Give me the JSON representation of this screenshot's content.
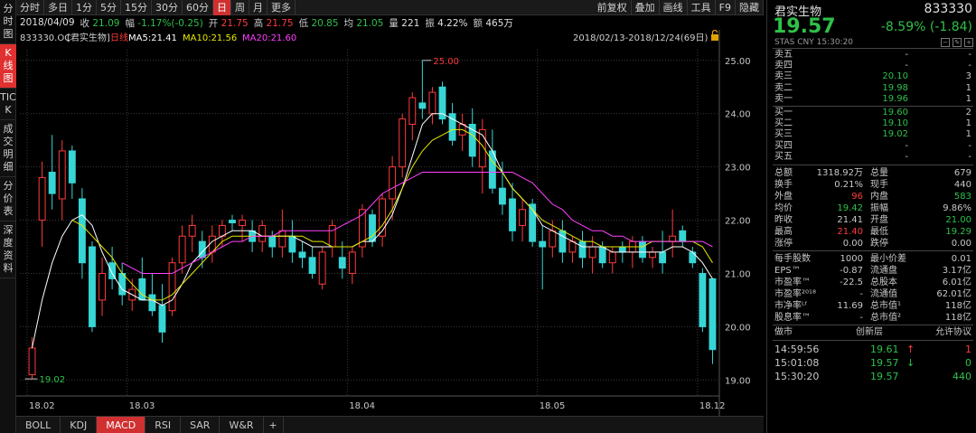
{
  "sidebar": [
    "分时图",
    "K线图",
    "TICK",
    "成交明细",
    "分价表",
    "深度资料"
  ],
  "toolbar": {
    "tabs": [
      "分时",
      "多日",
      "1分",
      "5分",
      "15分",
      "30分",
      "60分",
      "日",
      "周",
      "月",
      "更多"
    ],
    "active": "日",
    "right": [
      "前复权",
      "叠加",
      "画线",
      "工具",
      "F9",
      "隐藏"
    ]
  },
  "info": {
    "date": "2018/04/09",
    "recv_l": "收",
    "recv": "21.09",
    "amp_l": "幅",
    "amp": "-1.17%(-0.25)",
    "open_l": "开",
    "open": "21.75",
    "high_l": "高",
    "high": "21.75",
    "low_l": "低",
    "low": "20.85",
    "avg_l": "均",
    "avg": "21.05",
    "vol_l": "量",
    "vol": "221",
    "swing_l": "振",
    "swing": "4.22%",
    "amt_l": "额",
    "amt": "465万"
  },
  "legend": {
    "code": "833330.OC",
    "name": "[君实生物]",
    "period": "日线",
    "ma5": "MA5:21.41",
    "ma10": "MA10:21.56",
    "ma20": "MA20:21.60",
    "range": "2018/02/13-2018/12/24(69日)"
  },
  "chart_data": {
    "type": "candlestick",
    "ylim": [
      18.7,
      25.2
    ],
    "y_ticks": [
      19.0,
      20.0,
      21.0,
      22.0,
      23.0,
      24.0,
      25.0
    ],
    "x_ticks": [
      "18.02",
      "18.03",
      "18.04",
      "18.05",
      "18.12"
    ],
    "max_label": "25.00",
    "min_label": "19.02",
    "ohlc": [
      [
        19.1,
        19.8,
        19.02,
        19.6
      ],
      [
        22.0,
        23.1,
        21.5,
        22.8
      ],
      [
        22.9,
        23.6,
        22.2,
        22.5
      ],
      [
        22.4,
        23.5,
        22.0,
        23.3
      ],
      [
        23.3,
        23.4,
        22.4,
        22.7
      ],
      [
        22.4,
        22.6,
        20.9,
        21.2
      ],
      [
        21.5,
        21.6,
        19.9,
        20.0
      ],
      [
        20.5,
        21.3,
        20.2,
        21.0
      ],
      [
        21.2,
        21.5,
        20.7,
        20.9
      ],
      [
        21.0,
        21.2,
        20.4,
        20.6
      ],
      [
        20.5,
        20.9,
        20.3,
        20.7
      ],
      [
        20.9,
        21.3,
        20.5,
        20.5
      ],
      [
        20.6,
        21.0,
        20.2,
        20.3
      ],
      [
        20.4,
        20.8,
        19.7,
        19.9
      ],
      [
        20.3,
        21.3,
        20.2,
        21.2
      ],
      [
        21.2,
        21.9,
        21.0,
        21.7
      ],
      [
        21.7,
        22.1,
        21.4,
        21.9
      ],
      [
        21.6,
        21.8,
        21.1,
        21.3
      ],
      [
        21.4,
        21.9,
        21.2,
        21.7
      ],
      [
        21.7,
        22.0,
        21.5,
        21.9
      ],
      [
        22.0,
        22.1,
        21.8,
        21.95
      ],
      [
        21.9,
        22.1,
        21.6,
        22.0
      ],
      [
        21.8,
        22.0,
        21.4,
        21.6
      ],
      [
        21.6,
        22.0,
        21.4,
        21.9
      ],
      [
        21.7,
        21.8,
        21.3,
        21.5
      ],
      [
        21.5,
        22.2,
        21.3,
        21.8
      ],
      [
        21.7,
        22.0,
        21.2,
        21.4
      ],
      [
        21.4,
        21.6,
        21.1,
        21.3
      ],
      [
        21.3,
        21.5,
        20.9,
        21.0
      ],
      [
        20.8,
        21.5,
        20.7,
        21.4
      ],
      [
        21.5,
        22.0,
        21.3,
        21.9
      ],
      [
        21.3,
        21.6,
        20.9,
        21.1
      ],
      [
        21.0,
        21.5,
        20.8,
        21.4
      ],
      [
        21.5,
        22.3,
        21.3,
        22.2
      ],
      [
        22.1,
        22.2,
        21.5,
        21.6
      ],
      [
        21.7,
        22.5,
        21.5,
        22.4
      ],
      [
        22.4,
        23.2,
        22.0,
        23.0
      ],
      [
        23.0,
        24.0,
        22.8,
        23.9
      ],
      [
        23.8,
        24.4,
        23.5,
        24.3
      ],
      [
        24.2,
        25.0,
        23.9,
        24.1
      ],
      [
        24.0,
        24.5,
        23.8,
        24.4
      ],
      [
        24.5,
        24.6,
        23.8,
        23.9
      ],
      [
        24.0,
        24.2,
        23.4,
        23.5
      ],
      [
        23.6,
        24.0,
        23.3,
        23.8
      ],
      [
        23.8,
        24.1,
        23.0,
        23.2
      ],
      [
        23.0,
        23.9,
        22.5,
        23.7
      ],
      [
        23.3,
        23.7,
        22.5,
        22.6
      ],
      [
        22.6,
        23.1,
        22.1,
        22.3
      ],
      [
        22.4,
        22.7,
        21.6,
        21.8
      ],
      [
        21.9,
        22.4,
        21.6,
        22.2
      ],
      [
        22.3,
        22.4,
        21.5,
        21.6
      ],
      [
        21.6,
        21.9,
        20.7,
        21.5
      ],
      [
        21.5,
        22.0,
        21.3,
        21.8
      ],
      [
        21.8,
        22.0,
        21.2,
        21.4
      ],
      [
        21.4,
        21.7,
        21.2,
        21.6
      ],
      [
        21.6,
        21.8,
        21.1,
        21.3
      ],
      [
        21.3,
        21.7,
        21.0,
        21.5
      ],
      [
        21.5,
        21.6,
        21.1,
        21.2
      ],
      [
        21.2,
        21.5,
        21.0,
        21.4
      ],
      [
        21.5,
        21.6,
        21.2,
        21.4
      ],
      [
        21.4,
        21.7,
        21.1,
        21.6
      ],
      [
        21.6,
        21.7,
        21.2,
        21.3
      ],
      [
        21.3,
        21.5,
        21.1,
        21.4
      ],
      [
        21.4,
        21.8,
        21.0,
        21.2
      ],
      [
        21.6,
        22.2,
        21.3,
        21.7
      ],
      [
        21.8,
        21.9,
        21.5,
        21.6
      ],
      [
        21.4,
        21.5,
        21.1,
        21.2
      ],
      [
        21.0,
        21.1,
        19.9,
        20.0
      ],
      [
        20.9,
        20.9,
        19.3,
        19.57
      ]
    ],
    "ma5": [
      19.6,
      20.5,
      21.2,
      21.7,
      22.0,
      22.1,
      21.9,
      21.4,
      21.0,
      20.7,
      20.6,
      20.5,
      20.5,
      20.4,
      20.5,
      20.8,
      21.2,
      21.4,
      21.6,
      21.7,
      21.8,
      21.8,
      21.8,
      21.7,
      21.7,
      21.7,
      21.7,
      21.6,
      21.5,
      21.5,
      21.5,
      21.5,
      21.5,
      21.6,
      21.6,
      21.8,
      22.1,
      22.6,
      23.2,
      23.8,
      24.0,
      24.0,
      23.9,
      23.8,
      23.7,
      23.6,
      23.3,
      22.9,
      22.6,
      22.4,
      22.2,
      21.9,
      21.8,
      21.7,
      21.6,
      21.5,
      21.5,
      21.5,
      21.4,
      21.4,
      21.4,
      21.4,
      21.4,
      21.4,
      21.5,
      21.5,
      21.4,
      21.2,
      20.9
    ],
    "ma10": [
      null,
      null,
      null,
      null,
      22.0,
      21.9,
      21.7,
      21.5,
      21.3,
      21.0,
      20.8,
      20.6,
      20.5,
      20.5,
      20.6,
      20.8,
      21.0,
      21.2,
      21.4,
      21.6,
      21.7,
      21.7,
      21.7,
      21.7,
      21.7,
      21.7,
      21.7,
      21.7,
      21.6,
      21.6,
      21.5,
      21.5,
      21.5,
      21.6,
      21.7,
      21.9,
      22.2,
      22.6,
      23.0,
      23.3,
      23.5,
      23.6,
      23.7,
      23.7,
      23.6,
      23.4,
      23.1,
      22.9,
      22.6,
      22.4,
      22.2,
      22.0,
      21.9,
      21.8,
      21.7,
      21.6,
      21.6,
      21.5,
      21.5,
      21.5,
      21.5,
      21.5,
      21.6,
      21.6,
      21.6,
      21.6,
      21.6,
      21.5,
      21.2
    ],
    "ma20": [
      null,
      null,
      null,
      null,
      null,
      null,
      null,
      null,
      null,
      21.2,
      21.1,
      21.0,
      21.0,
      21.0,
      21.0,
      21.1,
      21.2,
      21.3,
      21.4,
      21.5,
      21.6,
      21.6,
      21.7,
      21.7,
      21.7,
      21.8,
      21.8,
      21.8,
      21.8,
      21.8,
      21.8,
      21.9,
      22.0,
      22.1,
      22.3,
      22.5,
      22.6,
      22.7,
      22.8,
      22.9,
      22.9,
      22.9,
      22.9,
      22.9,
      22.9,
      22.9,
      22.9,
      22.9,
      22.9,
      22.8,
      22.7,
      22.5,
      22.3,
      22.2,
      22.0,
      21.9,
      21.8,
      21.8,
      21.7,
      21.7,
      21.6,
      21.6,
      21.6,
      21.6,
      21.6,
      21.6,
      21.6,
      21.6,
      21.5
    ]
  },
  "bottom_tabs": [
    "BOLL",
    "KDJ",
    "MACD",
    "RSI",
    "SAR",
    "W&R"
  ],
  "bottom_active": "MACD",
  "bottom_plus": "+",
  "right": {
    "name": "君实生物",
    "code": "833330",
    "price": "19.57",
    "change": "-8.59% (-1.84)",
    "sub": "STAS  CNY     15:30:20",
    "icons": {
      "sub_icon": "−",
      "set_icon": "✎",
      "add_icon": "+"
    },
    "asks": [
      [
        "卖五",
        "-",
        "-"
      ],
      [
        "卖四",
        "-",
        "-"
      ],
      [
        "卖三",
        "20.10",
        "3"
      ],
      [
        "卖二",
        "19.98",
        "1"
      ],
      [
        "卖一",
        "19.96",
        "1"
      ]
    ],
    "bids": [
      [
        "买一",
        "19.60",
        "2"
      ],
      [
        "买二",
        "19.10",
        "1"
      ],
      [
        "买三",
        "19.02",
        "1"
      ],
      [
        "买四",
        "-",
        "-"
      ],
      [
        "买五",
        "-",
        "-"
      ]
    ],
    "stats1": [
      [
        "总额",
        "1318.92万",
        "总量",
        "679"
      ],
      [
        "换手",
        "0.21%",
        "现手",
        "440"
      ],
      [
        "外盘",
        "96",
        "内盘",
        "583"
      ],
      [
        "均价",
        "19.42",
        "振幅",
        "9.86%"
      ],
      [
        "昨收",
        "21.41",
        "开盘",
        "21.00"
      ],
      [
        "最高",
        "21.40",
        "最低",
        "19.29"
      ],
      [
        "涨停",
        "0.00",
        "跌停",
        "0.00"
      ]
    ],
    "stats2": [
      [
        "每手股数",
        "1000",
        "最小价差",
        "0.01"
      ],
      [
        "EPS™",
        "-0.87",
        "流通盘",
        "3.17亿"
      ],
      [
        "市盈率™",
        "-22.5",
        "总股本",
        "6.01亿"
      ],
      [
        "市盈率²⁰¹⁸",
        "-",
        "流通值",
        "62.01亿"
      ],
      [
        "市净率ᴸᶠ",
        "11.69",
        "总市值¹",
        "118亿"
      ],
      [
        "股息率™",
        "-",
        "总市值²",
        "118亿"
      ]
    ],
    "market": [
      "做市",
      "创新层",
      "允许协议"
    ],
    "ticks": [
      [
        "14:59:56",
        "19.61",
        "↑",
        "1"
      ],
      [
        "15:01:08",
        "19.57",
        "↓",
        "0"
      ],
      [
        "15:30:20",
        "19.57",
        "",
        "440"
      ]
    ]
  }
}
